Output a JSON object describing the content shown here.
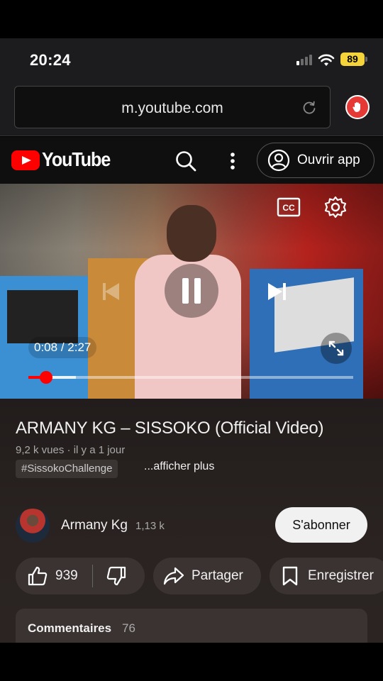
{
  "status_bar": {
    "time": "20:24",
    "battery": "89"
  },
  "browser": {
    "url": "m.youtube.com"
  },
  "header": {
    "logo_text": "YouTube",
    "open_app_label": "Ouvrir app"
  },
  "player": {
    "current_time": "0:08",
    "time_separator": "/",
    "duration": "2:27",
    "played_fraction": 0.054,
    "buffered_fraction": 0.146,
    "accent_color": "#ff0000"
  },
  "video": {
    "title": "ARMANY KG – SISSOKO (Official Video)",
    "meta": "9,2 k vues · il y a 1 jour",
    "hashtag": "#SissokoChallenge",
    "show_more": "...afficher plus"
  },
  "channel": {
    "name": "Armany Kg",
    "subscribers": "1,13 k",
    "subscribe_label": "S'abonner"
  },
  "actions": {
    "likes": "939",
    "share_label": "Partager",
    "save_label": "Enregistrer"
  },
  "comments": {
    "label": "Commentaires",
    "count": "76"
  }
}
